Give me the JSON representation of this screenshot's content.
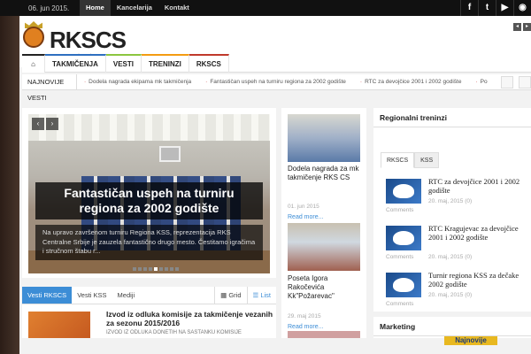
{
  "topbar": {
    "date": "06. jun 2015.",
    "links": [
      {
        "label": "Home"
      },
      {
        "label": "Kancelarija"
      },
      {
        "label": "Kontakt"
      }
    ],
    "social": [
      "f",
      "t",
      "y",
      "rss"
    ]
  },
  "header": {
    "logo_text": "RKSCS",
    "logo_sub": "REGIONALNI KOŠARKAŠKI SAVEZ CENTRALNA SRBIJA"
  },
  "nav": {
    "items": [
      {
        "label": "TAKMIČENJA",
        "color": "#2e6fc0"
      },
      {
        "label": "VESTI",
        "color": "#8cc63f"
      },
      {
        "label": "TRENINZI",
        "color": "#f39c12"
      },
      {
        "label": "RKSCS",
        "color": "#c0392b"
      }
    ]
  },
  "ticker": {
    "label": "NAJNOVIJE VESTI",
    "items": [
      "Dodela nagrada ekipama mk takmičenja",
      "Fantastičan uspeh na turniru regiona za 2002 godište",
      "RTC za devojčice 2001 i 2002 godište",
      "Po"
    ]
  },
  "slider": {
    "title": "Fantastičan uspeh na turniru regiona za 2002 godište",
    "text": "Na upravo završenom turniru Regiona KSS, reprezentacija RKS Centralne Srbije je zauzela fantastično drugo mesto. Čestitamo igračima i stručnom štabu r..."
  },
  "tabs": {
    "items": [
      "Vesti RKSCS",
      "Vesti KSS",
      "Mediji"
    ],
    "views": [
      "Grid",
      "List"
    ],
    "article_title": "Izvod iz odluka komisije za takmičenje vezanih za sezonu 2015/2016",
    "article_sub": "IZVOD IZ ODLUKA DONETIH NA SASTANKU KOMISIJE"
  },
  "middle": {
    "posts": [
      {
        "title": "Dodela nagrada za mk takmičenje RKS CS",
        "date": "01. jun 2015",
        "more": "Read more..."
      },
      {
        "title": "Poseta Igora Rakočevića Kk\"Požarevac\"",
        "date": "29. maj 2015",
        "more": "Read more..."
      }
    ]
  },
  "sidebar": {
    "title": "Regionalni treninzi",
    "tabs": [
      "RKSCS",
      "KSS"
    ],
    "items": [
      {
        "title": "RTC za devojčice 2001 i 2002 godište",
        "date": "20. maj, 2015",
        "comments": "(0)",
        "comments_label": "Comments"
      },
      {
        "title": "RTC Kragujevac za devojčice 2001 i 2002 godište",
        "date": "20. maj, 2015",
        "comments": "(0)",
        "comments_label": "Comments"
      },
      {
        "title": "Turnir regiona KSS za dečake 2002 godište",
        "date": "20. maj, 2015",
        "comments": "(0)",
        "comments_label": "Comments"
      }
    ],
    "marketing_title": "Marketing",
    "marketing_badge": "Najnovije"
  }
}
